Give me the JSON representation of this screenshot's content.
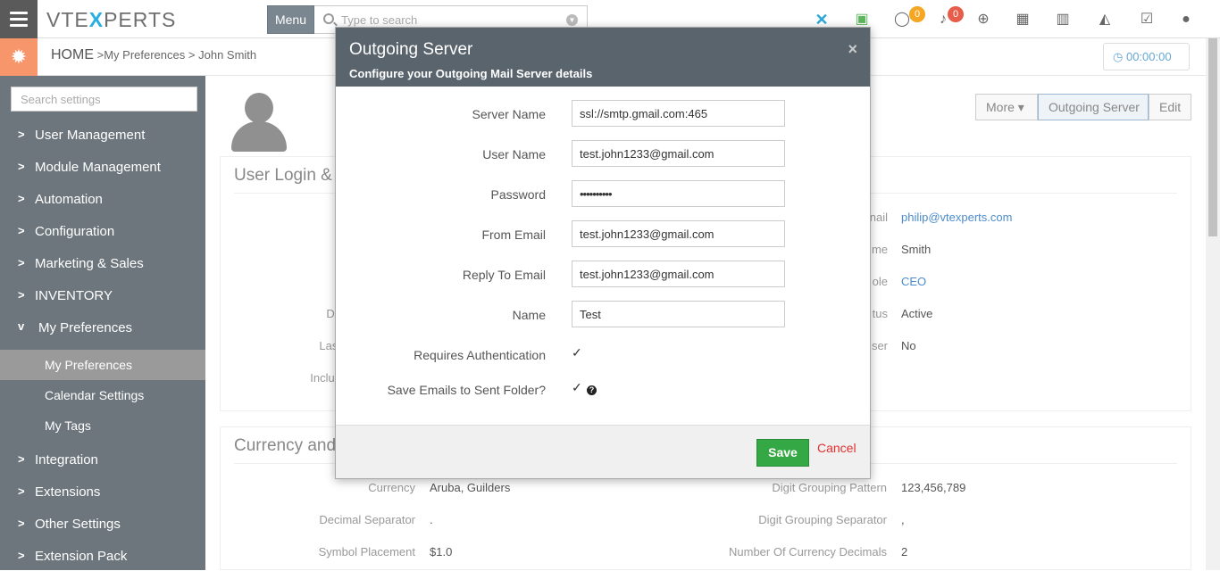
{
  "header": {
    "logo_left": "VTE",
    "logo_x": "X",
    "logo_right": "PERTS",
    "menu_label": "Menu",
    "search_placeholder": "Type to search",
    "chat_count": "0",
    "notification_count": "0",
    "icons": [
      "vtiger-x-icon",
      "calendar-check-icon",
      "chat-icon",
      "bell-icon",
      "plus-circle-icon",
      "calendar-icon",
      "bar-chart-icon",
      "area-chart-icon",
      "checkbox-icon",
      "user-icon"
    ],
    "accent_badge_color": "#f5a623",
    "notif_badge_color": "#e85c4a"
  },
  "breadcrumb": {
    "home": "HOME",
    "sep": ">",
    "level1": "My Preferences",
    "level2": "John Smith"
  },
  "timer": "00:00:00",
  "sidebar": {
    "search_placeholder": "Search settings",
    "items": [
      {
        "label": "User Management"
      },
      {
        "label": "Module Management"
      },
      {
        "label": "Automation"
      },
      {
        "label": "Configuration"
      },
      {
        "label": "Marketing & Sales"
      },
      {
        "label": "INVENTORY"
      },
      {
        "label": "My Preferences"
      }
    ],
    "sub_items": [
      {
        "label": "My Preferences"
      },
      {
        "label": "Calendar Settings"
      },
      {
        "label": "My Tags"
      }
    ],
    "items_after": [
      {
        "label": "Integration"
      },
      {
        "label": "Extensions"
      },
      {
        "label": "Other Settings"
      },
      {
        "label": "Extension Pack"
      }
    ]
  },
  "actions": {
    "more": "More",
    "outgoing_server": "Outgoing Server",
    "edit": "Edit"
  },
  "login_card": {
    "title": "User Login &",
    "left_labels": [
      "De",
      "Last",
      "Includ"
    ],
    "right_labels": [
      "nail",
      "me",
      "ole",
      "tus",
      "ser"
    ],
    "right_values": [
      "philip@vtexperts.com",
      "Smith",
      "CEO",
      "Active",
      "No"
    ]
  },
  "currency_card": {
    "title": "Currency and",
    "rows": [
      {
        "label": "Currency",
        "value": "Aruba, Guilders",
        "label2": "Digit Grouping Pattern",
        "value2": "123,456,789"
      },
      {
        "label": "Decimal Separator",
        "value": ".",
        "label2": "Digit Grouping Separator",
        "value2": ","
      },
      {
        "label": "Symbol Placement",
        "value": "$1.0",
        "label2": "Number Of Currency Decimals",
        "value2": "2"
      }
    ]
  },
  "modal": {
    "title": "Outgoing Server",
    "subtitle": "Configure your Outgoing Mail Server details",
    "close": "×",
    "fields": [
      {
        "label": "Server Name",
        "value": "ssl://smtp.gmail.com:465"
      },
      {
        "label": "User Name",
        "value": "test.john1233@gmail.com"
      },
      {
        "label": "Password",
        "value": "••••••••••"
      },
      {
        "label": "From Email",
        "value": "test.john1233@gmail.com"
      },
      {
        "label": "Reply To Email",
        "value": "test.john1233@gmail.com"
      },
      {
        "label": "Name",
        "value": "Test"
      }
    ],
    "requires_auth_label": "Requires Authentication",
    "requires_auth_checked": true,
    "save_sent_label": "Save Emails to Sent Folder?",
    "save_sent_checked": true,
    "save_label": "Save",
    "cancel_label": "Cancel"
  }
}
